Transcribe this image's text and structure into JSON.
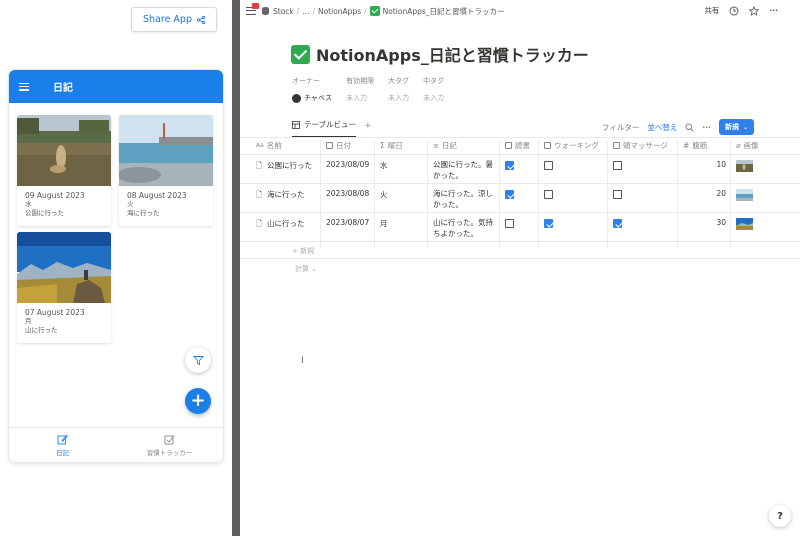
{
  "left": {
    "share_button": "Share App",
    "app_title": "日記",
    "cards": [
      {
        "date": "09 August 2023",
        "dow": "水",
        "text": "公園に行った"
      },
      {
        "date": "08 August 2023",
        "dow": "火",
        "text": "海に行った"
      },
      {
        "date": "07 August 2023",
        "dow": "月",
        "text": "山に行った"
      }
    ],
    "bottom_nav": [
      {
        "label": "日記",
        "icon": "edit-icon",
        "active": true
      },
      {
        "label": "習慣トラッカー",
        "icon": "checkbox-icon",
        "active": false
      }
    ],
    "accent_color": "#1a7fe8"
  },
  "right": {
    "breadcrumb": [
      "Stock",
      "...",
      "NotionApps",
      "NotionApps_日記と習慣トラッカー"
    ],
    "share_label": "共有",
    "page_title": "NotionApps_日記と習慣トラッカー",
    "properties": [
      {
        "label": "オーナー",
        "value": "チャベス"
      },
      {
        "label": "有効期限",
        "value": "未入力"
      },
      {
        "label": "大タグ",
        "value": "未入力"
      },
      {
        "label": "中タグ",
        "value": "未入力"
      }
    ],
    "view_tab": "テーブルビュー",
    "view_add": "+",
    "filter_label": "フィルター",
    "sort_label": "並べ替え",
    "new_button": "新規",
    "columns": {
      "name": "名前",
      "date": "日付",
      "weekday": "曜日",
      "diary": "日記",
      "reading": "読書",
      "walking": "ウォーキング",
      "massage": "頭マッサージ",
      "pushups": "腹筋",
      "image": "画像",
      "name_prefix": "Aa",
      "pushups_prefix": "#",
      "weekday_prefix": "Σ"
    },
    "rows": [
      {
        "name": "公園に行った",
        "date": "2023/08/09",
        "weekday": "水",
        "diary": "公園に行った。暑かった。",
        "reading": true,
        "walking": false,
        "massage": false,
        "pushups": "10"
      },
      {
        "name": "海に行った",
        "date": "2023/08/08",
        "weekday": "火",
        "diary": "海に行った。涼しかった。",
        "reading": true,
        "walking": false,
        "massage": false,
        "pushups": "20"
      },
      {
        "name": "山に行った",
        "date": "2023/08/07",
        "weekday": "月",
        "diary": "山に行った。気持ちよかった。",
        "reading": false,
        "walking": true,
        "massage": true,
        "pushups": "30"
      }
    ],
    "new_row_label": "新規",
    "calc_label": "計算 ⌄",
    "help_label": "?",
    "accent_color": "#2f80ed",
    "title_check_color": "#2eaa4f"
  }
}
